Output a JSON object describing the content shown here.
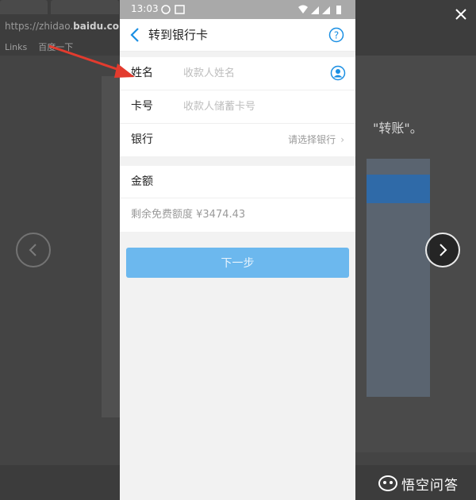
{
  "status_bar": {
    "time": "13:03"
  },
  "header": {
    "title": "转到银行卡"
  },
  "form": {
    "name_label": "姓名",
    "name_placeholder": "收款人姓名",
    "card_label": "卡号",
    "card_placeholder": "收款人储蓄卡号",
    "bank_label": "银行",
    "bank_select": "请选择银行"
  },
  "amount": {
    "label": "金额",
    "free_quota": "剩余免费额度 ¥3474.43"
  },
  "next_button": {
    "label": "下一步",
    "color": "#6cb8ee"
  },
  "background": {
    "url_prefix": "https://zhidao.",
    "url_domain": "baidu.com",
    "bookmark_1": "Links",
    "bookmark_2": "百度一下",
    "right_text": "\"转账\"。"
  },
  "watermark": {
    "text": "悟空问答"
  },
  "colors": {
    "accent": "#1a8fe3",
    "arrow": "#e33b2e"
  }
}
